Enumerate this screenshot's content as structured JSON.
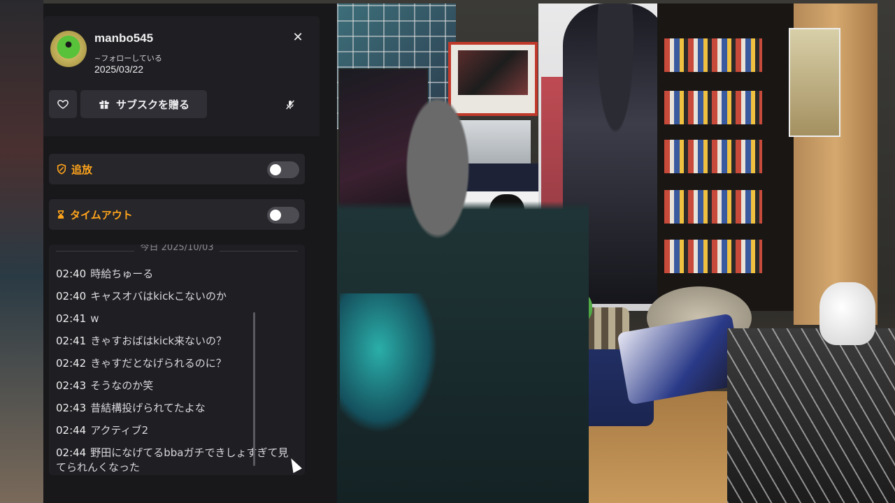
{
  "user_card": {
    "username": "manbo545",
    "follow_status": "~フォローしている",
    "follow_date": "2025/03/22",
    "close_icon": "close-icon",
    "gift_sub_label": "サブスクを贈る"
  },
  "moderation": {
    "ban_label": "追放",
    "ban_enabled": false,
    "timeout_label": "タイムアウト",
    "timeout_enabled": false
  },
  "history": {
    "date_divider": "今日 2025/10/03",
    "messages": [
      {
        "time": "02:40",
        "text": "時給ちゅーる"
      },
      {
        "time": "02:40",
        "text": "キャスオバはkickこないのか"
      },
      {
        "time": "02:41",
        "text": "w"
      },
      {
        "time": "02:41",
        "text": "きゃすおばはkick来ないの？"
      },
      {
        "time": "02:42",
        "text": "きゃすだとなげられるのに？"
      },
      {
        "time": "02:43",
        "text": "そうなのか笑"
      },
      {
        "time": "02:43",
        "text": "昔結構投げられてたよな"
      },
      {
        "time": "02:44",
        "text": "アクティブ2"
      },
      {
        "time": "02:44",
        "text": "野田になげてるbbaガチできしょすぎて見てられんくなった"
      }
    ]
  },
  "colors": {
    "panel_bg": "#18181b",
    "row_bg": "#26262b",
    "mod_accent": "#ffa41b",
    "text": "#efeff1"
  }
}
